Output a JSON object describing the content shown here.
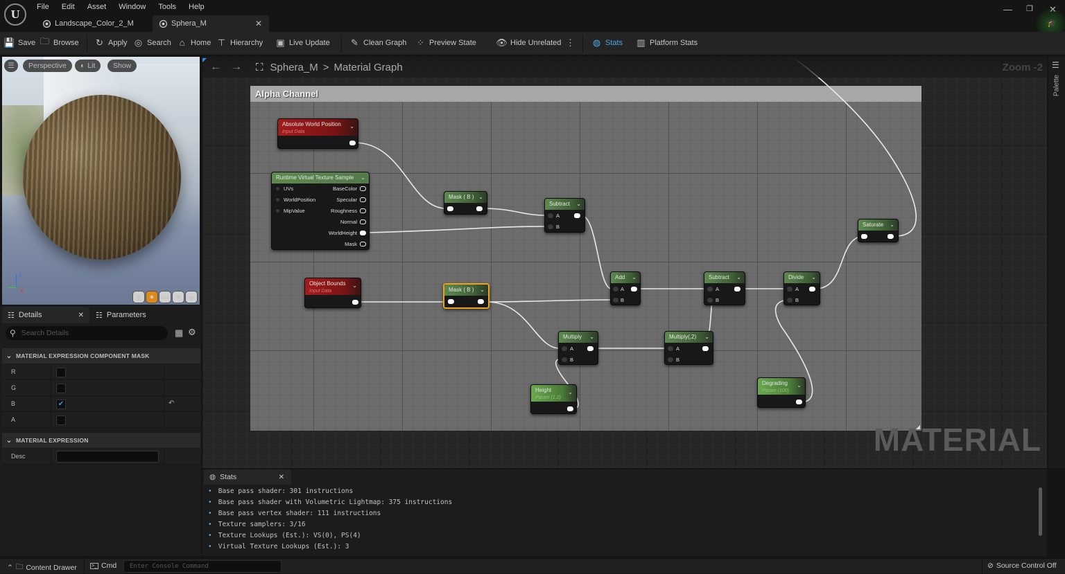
{
  "menu": [
    "File",
    "Edit",
    "Asset",
    "Window",
    "Tools",
    "Help"
  ],
  "doc_tabs": [
    {
      "label": "Landscape_Color_2_M",
      "active": false
    },
    {
      "label": "Sphera_M",
      "active": true
    }
  ],
  "toolbar": {
    "save": "Save",
    "browse": "Browse",
    "apply": "Apply",
    "search": "Search",
    "home": "Home",
    "hierarchy": "Hierarchy",
    "live_update": "Live Update",
    "clean_graph": "Clean Graph",
    "preview_state": "Preview State",
    "hide_unrelated": "Hide Unrelated",
    "stats": "Stats",
    "platform_stats": "Platform Stats"
  },
  "viewport": {
    "perspective": "Perspective",
    "lit": "Lit",
    "show": "Show"
  },
  "details": {
    "tab_details": "Details",
    "tab_parameters": "Parameters",
    "search_placeholder": "Search Details",
    "section1": "MATERIAL EXPRESSION COMPONENT MASK",
    "channels": [
      {
        "label": "R",
        "checked": false
      },
      {
        "label": "G",
        "checked": false
      },
      {
        "label": "B",
        "checked": true
      },
      {
        "label": "A",
        "checked": false
      }
    ],
    "section2": "MATERIAL EXPRESSION",
    "desc_label": "Desc",
    "desc_value": ""
  },
  "graph": {
    "breadcrumb_asset": "Sphera_M",
    "breadcrumb_sep": ">",
    "breadcrumb_graph": "Material Graph",
    "zoom": "Zoom -2",
    "comment": "Alpha Channel",
    "watermark": "MATERIAL",
    "palette": "Palette",
    "nodes": {
      "abs_world_pos": {
        "title": "Absolute World Position",
        "sub": "Input Data"
      },
      "rvt_sample": {
        "title": "Runtime Virtual Texture Sample",
        "inputs": [
          "UVs",
          "WorldPosition",
          "MipValue"
        ],
        "outputs": [
          "BaseColor",
          "Specular",
          "Roughness",
          "Normal",
          "WorldHeight",
          "Mask"
        ]
      },
      "mask1": {
        "title": "Mask ( B )"
      },
      "subtract1": {
        "title": "Subtract",
        "inputs": [
          "A",
          "B"
        ]
      },
      "object_bounds": {
        "title": "Object Bounds",
        "sub": "Input Data"
      },
      "mask2": {
        "title": "Mask ( B )"
      },
      "add": {
        "title": "Add",
        "inputs": [
          "A",
          "B"
        ]
      },
      "subtract2": {
        "title": "Subtract",
        "inputs": [
          "A",
          "B"
        ]
      },
      "divide": {
        "title": "Divide",
        "inputs": [
          "A",
          "B"
        ]
      },
      "saturate": {
        "title": "Saturate"
      },
      "multiply": {
        "title": "Multiply",
        "inputs": [
          "A",
          "B"
        ]
      },
      "multiply2": {
        "title": "Multiply(,2)",
        "inputs": [
          "A",
          "B"
        ]
      },
      "height": {
        "title": "Height",
        "sub": "Param (1,2)"
      },
      "degrading": {
        "title": "Degrading",
        "sub": "Param (100)"
      }
    }
  },
  "stats": {
    "tab": "Stats",
    "lines": [
      "Base pass shader: 301 instructions",
      "Base pass shader with Volumetric Lightmap: 375 instructions",
      "Base pass vertex shader: 111 instructions",
      "Texture samplers: 3/16",
      "Texture Lookups (Est.): VS(0), PS(4)",
      "Virtual Texture Lookups (Est.): 3"
    ]
  },
  "statusbar": {
    "content_drawer": "Content Drawer",
    "cmd": "Cmd",
    "console_placeholder": "Enter Console Command",
    "source_control": "Source Control Off"
  }
}
